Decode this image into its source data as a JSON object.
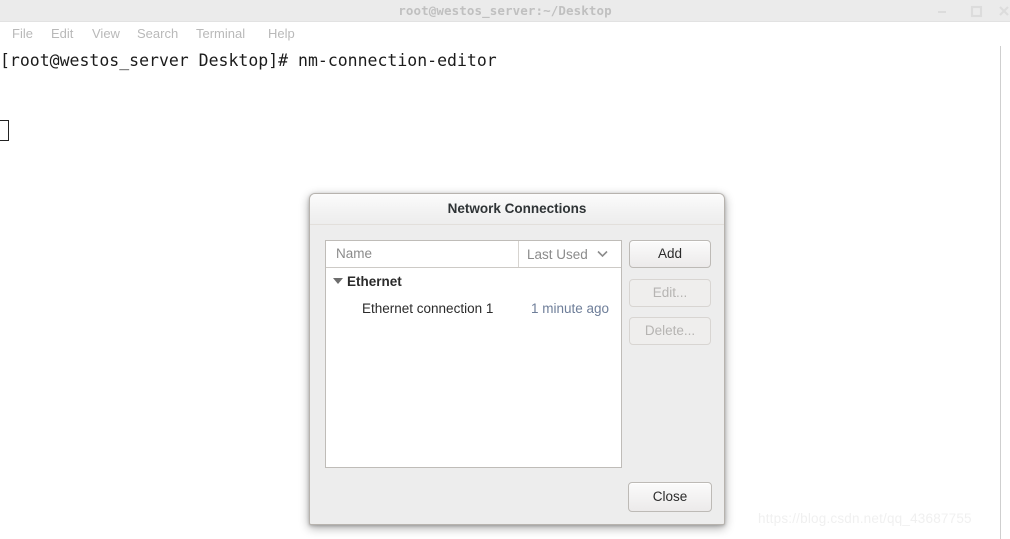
{
  "terminal": {
    "title": "root@westos_server:~/Desktop",
    "window_buttons": [
      {
        "name": "minimize",
        "glyph": "–"
      },
      {
        "name": "maximize",
        "glyph": "☐"
      },
      {
        "name": "close",
        "glyph": "✕"
      }
    ],
    "menu": [
      {
        "label": "File"
      },
      {
        "label": "Edit"
      },
      {
        "label": "View"
      },
      {
        "label": "Search"
      },
      {
        "label": "Terminal"
      },
      {
        "label": "Help"
      }
    ],
    "lines": [
      "[root@westos_server Desktop]# nm-connection-editor"
    ]
  },
  "dialog": {
    "title": "Network Connections",
    "columns": {
      "name": "Name",
      "last_used": "Last Used",
      "sort_icon": "chevron-down-icon"
    },
    "groups": [
      {
        "label": "Ethernet",
        "expanded": true,
        "connections": [
          {
            "name": "Ethernet connection 1",
            "last_used": "1 minute ago"
          }
        ]
      }
    ],
    "buttons": {
      "add": "Add",
      "edit": "Edit...",
      "delete": "Delete...",
      "close": "Close"
    },
    "button_states": {
      "add": "enabled",
      "edit": "disabled",
      "delete": "disabled",
      "close": "enabled"
    }
  },
  "watermark": "https://blog.csdn.net/qq_43687755",
  "colors": {
    "dialog_bg": "#ededed",
    "list_bg": "#ffffff",
    "last_used_text": "#6e7e99",
    "terminal_text": "#1b1b1b"
  }
}
